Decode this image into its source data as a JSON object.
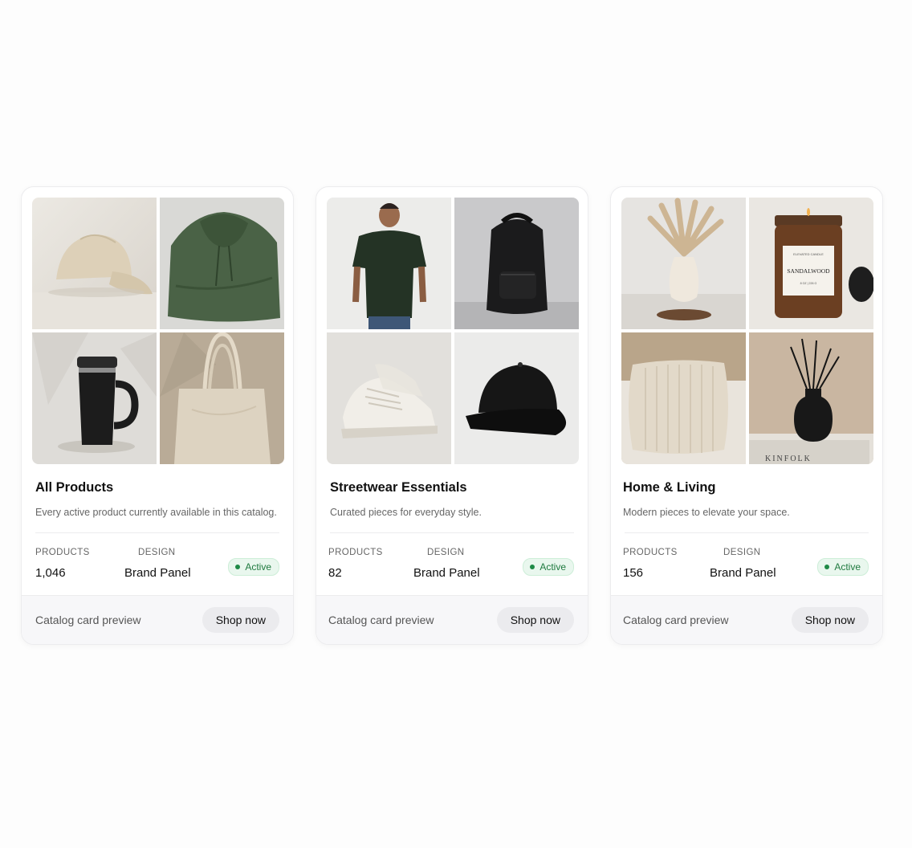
{
  "cards": [
    {
      "title": "All Products",
      "description": "Every active product currently available in this catalog.",
      "products_label": "PRODUCTS",
      "products_value": "1,046",
      "design_label": "DESIGN",
      "design_value": "Brand Panel",
      "status": "Active",
      "footer_label": "Catalog card preview",
      "cta": "Shop now",
      "images": [
        "cap-photo",
        "green-hoodie-photo",
        "tumbler-photo",
        "tote-bag-photo"
      ]
    },
    {
      "title": "Streetwear Essentials",
      "description": "Curated pieces for everyday style.",
      "products_label": "PRODUCTS",
      "products_value": "82",
      "design_label": "DESIGN",
      "design_value": "Brand Panel",
      "status": "Active",
      "footer_label": "Catalog card preview",
      "cta": "Shop now",
      "images": [
        "tshirt-model-photo",
        "backpack-photo",
        "sneakers-photo",
        "snapback-photo"
      ]
    },
    {
      "title": "Home & Living",
      "description": "Modern pieces to elevate your space.",
      "products_label": "PRODUCTS",
      "products_value": "156",
      "design_label": "DESIGN",
      "design_value": "Brand Panel",
      "status": "Active",
      "footer_label": "Catalog card preview",
      "cta": "Shop now",
      "images": [
        "vase-pampas-photo",
        "candle-photo",
        "pillow-photo",
        "diffuser-photo"
      ],
      "candle_brand": "ELEVATED CANDLE",
      "candle_label": "SANDALWOOD",
      "candle_size": "8 OZ | 226 G",
      "book_title": "KINFOLK"
    }
  ],
  "colors": {
    "accent_status": "#1f8a47",
    "badge_bg": "#e9f7ee",
    "button_bg": "#ebebee"
  }
}
